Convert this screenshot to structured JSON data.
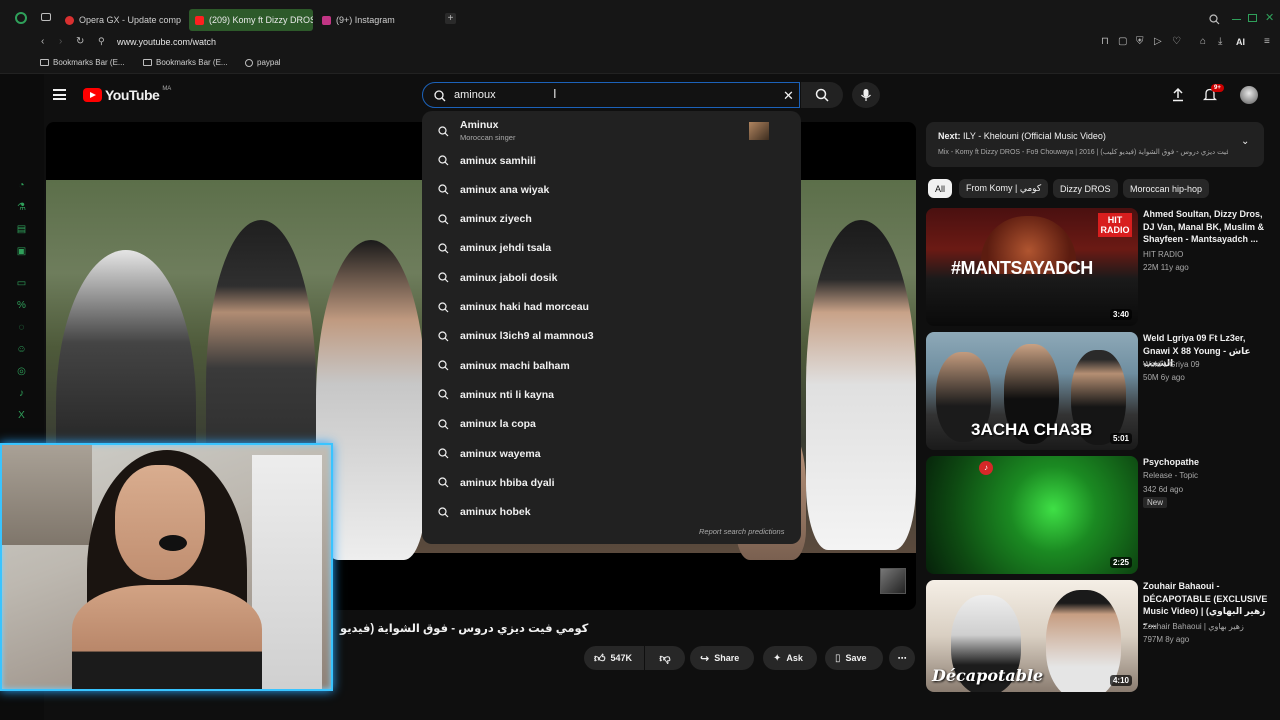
{
  "browser": {
    "tabs": [
      {
        "label": "Opera GX - Update comple",
        "color": "#d93030"
      },
      {
        "label": "(209) Komy ft Dizzy DROS",
        "color": "#ff2020"
      },
      {
        "label": "(9+) Instagram",
        "color": "#c13584"
      }
    ],
    "add_tab": "+",
    "url": "www.youtube.com/watch",
    "bookmarks": [
      "Bookmarks Bar (E...",
      "Bookmarks Bar (E...",
      "paypal"
    ],
    "ai_label": "AI"
  },
  "youtube": {
    "logo_text": "YouTube",
    "region": "MA",
    "search_value": "aminoux",
    "notification_count": "9+"
  },
  "suggestions": {
    "top": {
      "title": "Aminux",
      "subtitle": "Moroccan singer"
    },
    "items": [
      "aminux samhili",
      "aminux ana wiyak",
      "aminux ziyech",
      "aminux jehdi tsala",
      "aminux jaboli dosik",
      "aminux haki had morceau",
      "aminux l3ich9 al mamnou3",
      "aminux machi balham",
      "aminux nti li kayna",
      "aminux la copa",
      "aminux wayema",
      "aminux hbiba dyali",
      "aminux hobek"
    ],
    "report": "Report search predictions"
  },
  "video": {
    "title": "كومي فيت ديزي دروس - فوق الشواية (فيديو",
    "likes": "547K",
    "share": "Share",
    "ask": "Ask",
    "save": "Save",
    "more": "⋯"
  },
  "upnext": {
    "next_label": "Next:",
    "next_title": "ILY - Khelouni (Official Music Video)",
    "mix": "Mix - Komy ft Dizzy DROS - Fo9 Chouwaya | 2016 | كومي فيت ديزي دروس - فوق الشواية (فيديو كليب)",
    "chips": [
      "All",
      "From Komy | كومي",
      "Dizzy DROS",
      "Moroccan hip-hop"
    ],
    "videos": [
      {
        "title": "Ahmed Soultan, Dizzy Dros, DJ Van, Manal BK, Muslim & Shayfeen - Mantsayadch ...",
        "channel": "HIT RADIO",
        "meta": "22M  11y ago",
        "duration": "3:40",
        "thumb_text": "#MANTSAYADCH",
        "badge": "HIT RADIO"
      },
      {
        "title": "Weld Lgriya 09 Ft Lz3er, Gnawi X 88 Young - عاش الشعب",
        "channel": "Weld L'Griya 09",
        "meta": "50M  6y ago",
        "duration": "5:01",
        "thumb_text": "3ACHA CHA3B"
      },
      {
        "title": "Psychopathe",
        "channel": "Release - Topic",
        "meta": "342  6d ago",
        "new": "New",
        "duration": "2:25"
      },
      {
        "title": "Zouhair Bahaoui - DÉCAPOTABLE (EXCLUSIVE Music Video) | (زهير البهاوي - ...",
        "channel": "Zouhair Bahaoui | زهير بهاوي",
        "meta": "797M  8y ago",
        "duration": "4:10",
        "thumb_text": "Décapotable"
      }
    ]
  }
}
